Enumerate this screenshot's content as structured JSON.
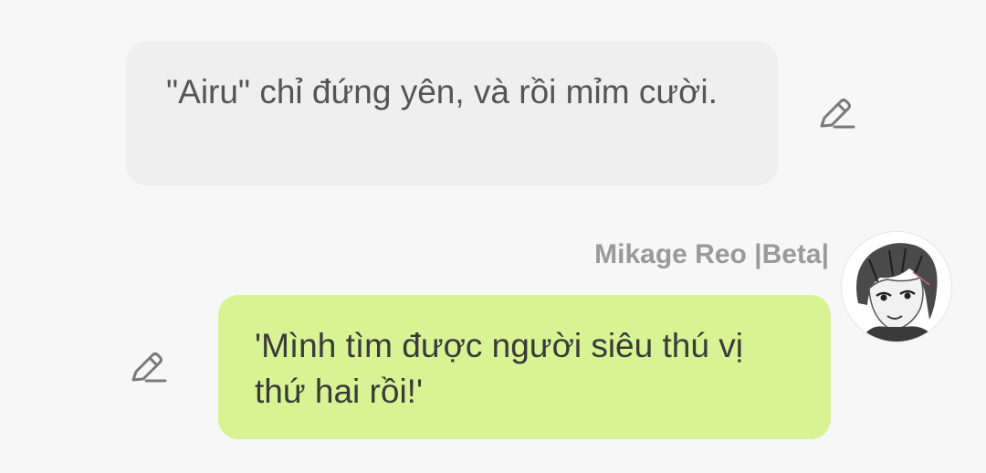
{
  "messages": [
    {
      "role": "user",
      "text": "\"Airu\" chỉ đứng yên, và rồi mỉm cười.",
      "action_icon": "pencil-edit-icon"
    },
    {
      "role": "character",
      "sender": "Mikage Reo |Beta|",
      "avatar_icon": "manga-portrait-avatar",
      "text": "'Mình tìm được người siêu thú vị thứ hai rồi!'",
      "action_icon": "pencil-edit-icon"
    }
  ],
  "colors": {
    "background": "#f7f7f7",
    "user_bubble": "#efefef",
    "character_bubble": "#d7f394",
    "sender_name": "#9a9a9a",
    "icon": "#7a7a7a"
  }
}
